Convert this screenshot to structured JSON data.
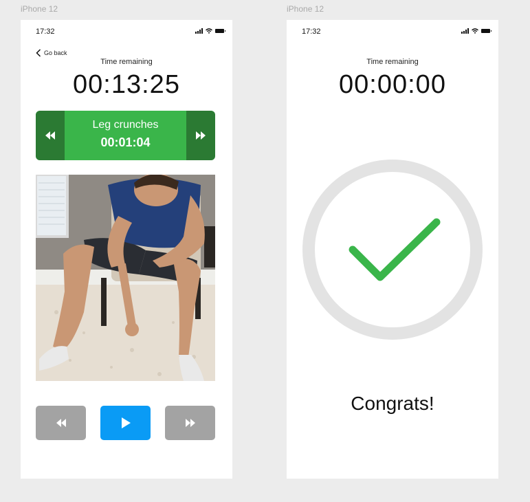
{
  "frames": [
    {
      "label": "iPhone 12",
      "status_time": "17:32",
      "go_back": "Go back",
      "time_label": "Time remaining",
      "time_remaining": "00:13:25",
      "exercise": {
        "name": "Leg crunches",
        "time": "00:01:04"
      },
      "controls": [
        "rewind-icon",
        "play-icon",
        "fast-forward-icon"
      ]
    },
    {
      "label": "iPhone 12",
      "status_time": "17:32",
      "time_label": "Time remaining",
      "time_remaining": "00:00:00",
      "message": "Congrats!"
    }
  ],
  "colors": {
    "green": "#3ab54a",
    "dark_green": "#2b7a33",
    "blue": "#0a9bf5",
    "gray_button": "#a3a3a3",
    "ring": "#e3e3e3"
  }
}
